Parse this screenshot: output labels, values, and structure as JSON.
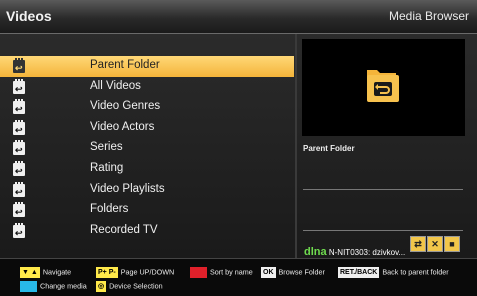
{
  "header": {
    "title": "Videos",
    "app_name": "Media Browser"
  },
  "list": {
    "selected_index": 0,
    "items": [
      {
        "label": "Parent Folder",
        "icon": "parent-folder-icon"
      },
      {
        "label": "All Videos",
        "icon": "folder-icon"
      },
      {
        "label": "Video Genres",
        "icon": "folder-icon"
      },
      {
        "label": "Video Actors",
        "icon": "folder-icon"
      },
      {
        "label": "Series",
        "icon": "folder-icon"
      },
      {
        "label": "Rating",
        "icon": "folder-icon"
      },
      {
        "label": "Video Playlists",
        "icon": "folder-icon"
      },
      {
        "label": "Folders",
        "icon": "folder-icon"
      },
      {
        "label": "Recorded TV",
        "icon": "folder-icon"
      }
    ]
  },
  "preview": {
    "label": "Parent Folder",
    "icon": "back-folder-icon"
  },
  "server": {
    "logo": "dlna",
    "name": "N-NIT0303: dzivkov..."
  },
  "footer": {
    "navigate": "Navigate",
    "page_keys": "P+ P-",
    "page": "Page UP/DOWN",
    "sort": "Sort by name",
    "ok_key": "OK",
    "browse": "Browse Folder",
    "ret_key": "RET./BACK",
    "back": "Back to parent folder",
    "change_media": "Change media",
    "device": "Device Selection"
  },
  "colors": {
    "selected": "#f4b43a",
    "accent_green": "#6fdc4f",
    "red_key": "#e0202a",
    "blue_key": "#28b9e8",
    "yellow_key": "#ffe94a"
  }
}
